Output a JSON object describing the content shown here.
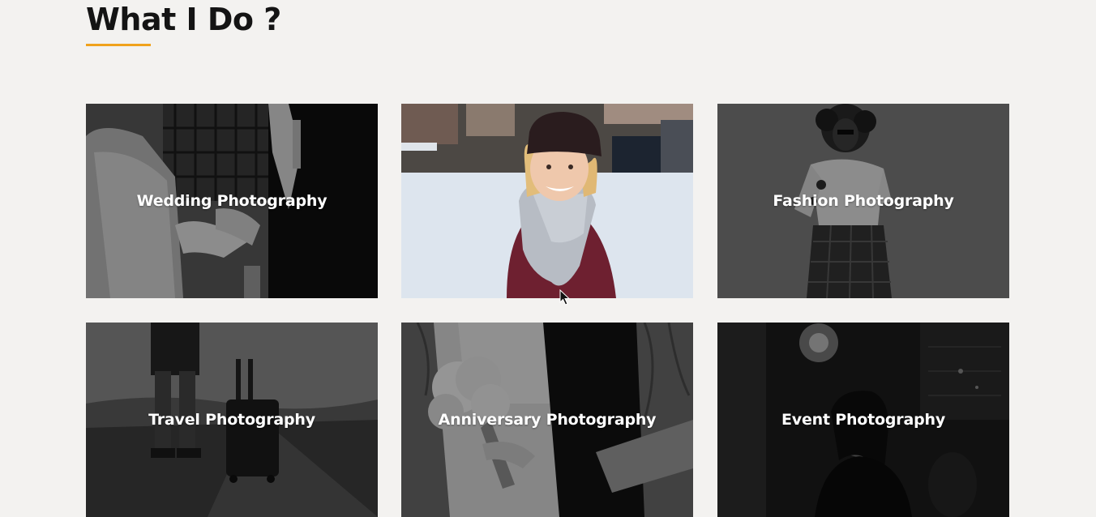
{
  "section": {
    "title": "What I Do ?",
    "underline_color": "#f0a21c"
  },
  "services": [
    {
      "label": "Wedding Photography",
      "hovered": false
    },
    {
      "label": "",
      "hovered": true
    },
    {
      "label": "Fashion Photography",
      "hovered": false
    },
    {
      "label": "Travel Photography",
      "hovered": false
    },
    {
      "label": "Anniversary Photography",
      "hovered": false
    },
    {
      "label": "Event Photography",
      "hovered": false
    }
  ],
  "colors": {
    "background": "#f3f2f0",
    "heading": "#141414",
    "accent": "#f0a21c",
    "card_text": "#ffffff"
  },
  "icons": {
    "cursor": "mouse-pointer-icon"
  }
}
